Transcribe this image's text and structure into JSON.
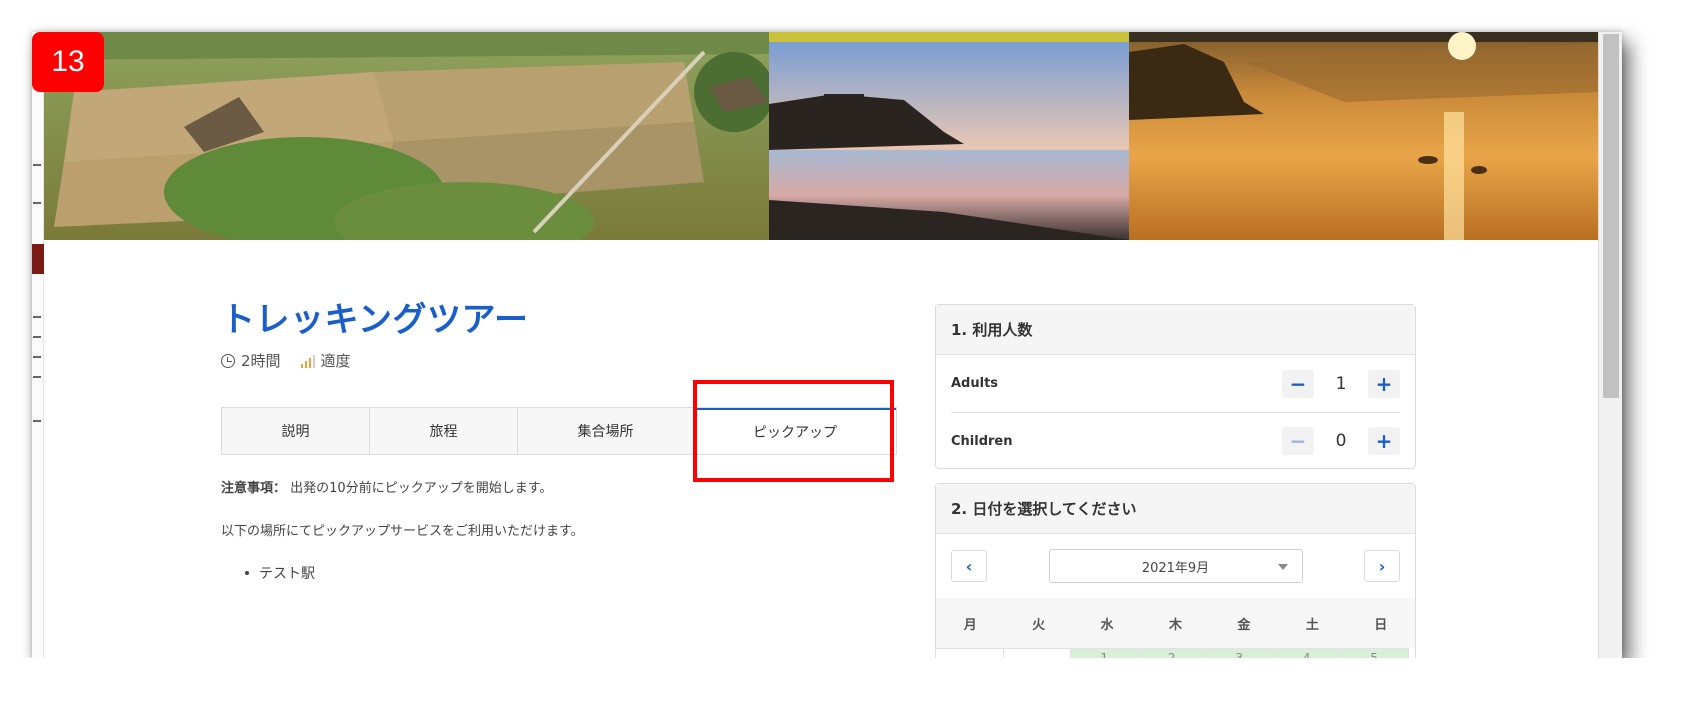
{
  "step_badge": "13",
  "tour": {
    "title": "トレッキングツアー",
    "duration": "2時間",
    "difficulty": "適度"
  },
  "tabs": [
    {
      "label": "説明",
      "active": false
    },
    {
      "label": "旅程",
      "active": false
    },
    {
      "label": "集合場所",
      "active": false
    },
    {
      "label": "ピックアップ",
      "active": true
    }
  ],
  "pickup": {
    "note_label": "注意事項：",
    "note_text": "出発の10分前にピックアップを開始します。",
    "service_text": "以下の場所にてピックアップサービスをご利用いただけます。",
    "locations": [
      "テスト駅"
    ]
  },
  "booking": {
    "people_title": "1. 利用人数",
    "adults": {
      "label": "Adults",
      "value": "1"
    },
    "children": {
      "label": "Children",
      "value": "0"
    },
    "minus_symbol": "−",
    "plus_symbol": "+",
    "date_title": "2. 日付を選択してください",
    "month": "2021年9月",
    "prev_symbol": "‹",
    "next_symbol": "›",
    "weekdays": [
      "月",
      "火",
      "水",
      "木",
      "金",
      "土",
      "日"
    ],
    "first_week": [
      "",
      "",
      "1",
      "2",
      "3",
      "4",
      "5"
    ]
  },
  "colors": {
    "accent": "#1a5ec9",
    "highlight": "#ff0000",
    "available_day": "#d8efd8"
  }
}
